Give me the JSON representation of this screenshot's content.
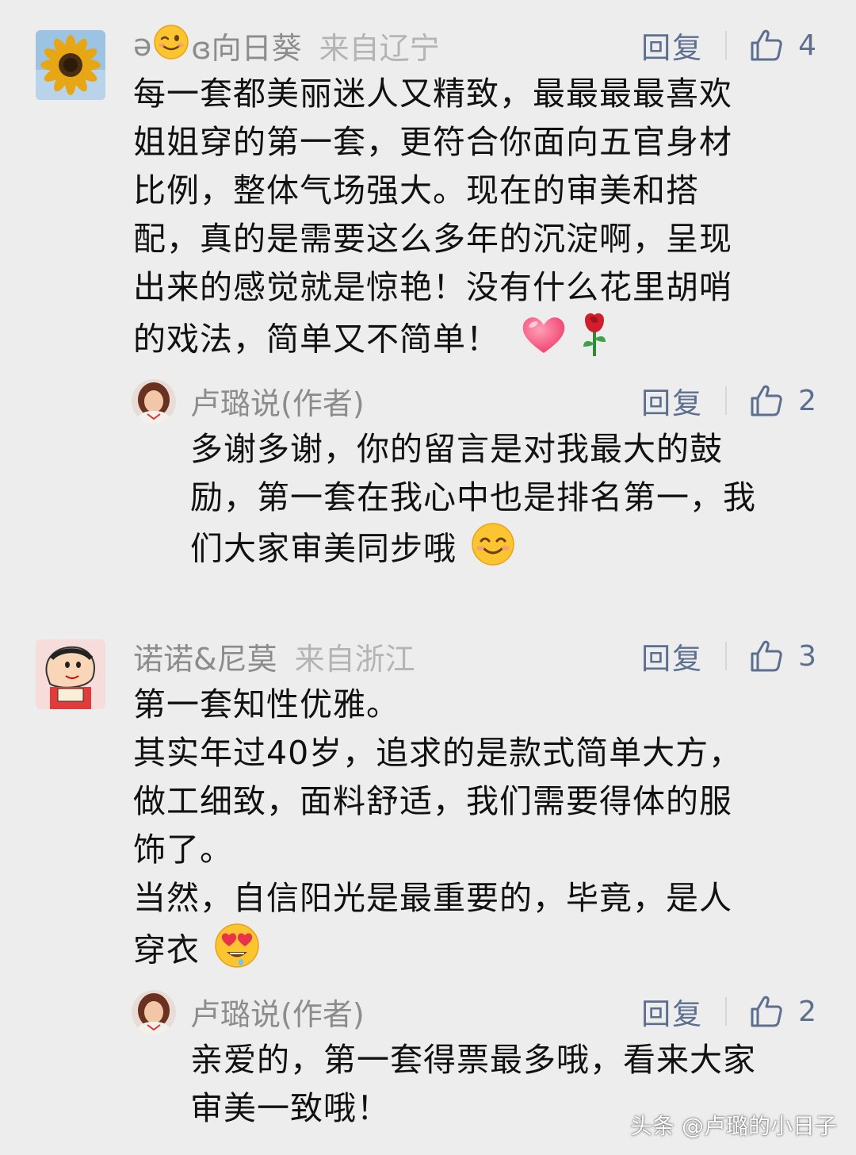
{
  "colors": {
    "background": "#ededed",
    "author": "#8c8c8c",
    "location": "#b4b4b4",
    "action": "#5d6f8f",
    "text": "#111111"
  },
  "comments": [
    {
      "author_prefix": "ә",
      "author_suffix": "ɞ向日葵",
      "author_emoji": "wink-emoji",
      "location": "来自辽宁",
      "reply_label": "回复",
      "likes": "4",
      "avatar_icon": "sunflower-avatar",
      "lines": [
        "每一套都美丽迷人又精致，最最最最喜欢",
        "姐姐穿的第一套，更符合你面向五官身材",
        "比例，整体气场强大。现在的审美和搭",
        "配，真的是需要这么多年的沉淀啊，呈现",
        "出来的感觉就是惊艳！没有什么花里胡哨",
        "的戏法，简单又不简单！"
      ],
      "trailing_icons": [
        "heart-emoji",
        "rose-emoji"
      ],
      "reply": {
        "author": "卢璐说(作者)",
        "reply_label": "回复",
        "likes": "2",
        "avatar_icon": "author-avatar",
        "lines": [
          "多谢多谢，你的留言是对我最大的鼓",
          "励，第一套在我心中也是排名第一，我",
          "们大家审美同步哦"
        ],
        "trailing_icon": "smile-emoji"
      }
    },
    {
      "author": "诺诺&尼莫",
      "location": "来自浙江",
      "reply_label": "回复",
      "likes": "3",
      "avatar_icon": "cartoon-avatar",
      "lines": [
        "第一套知性优雅。",
        "其实年过40岁，追求的是款式简单大方，",
        "做工细致，面料舒适，我们需要得体的服",
        "饰了。",
        "当然，自信阳光是最重要的，毕竟，是人",
        "穿衣"
      ],
      "trailing_icon": "heart-eyes-emoji",
      "reply": {
        "author": "卢璐说(作者)",
        "reply_label": "回复",
        "likes": "2",
        "avatar_icon": "author-avatar",
        "lines": [
          "亲爱的，第一套得票最多哦，看来大家",
          "审美一致哦！"
        ]
      }
    }
  ],
  "watermark": "头条 @卢璐的小日子"
}
